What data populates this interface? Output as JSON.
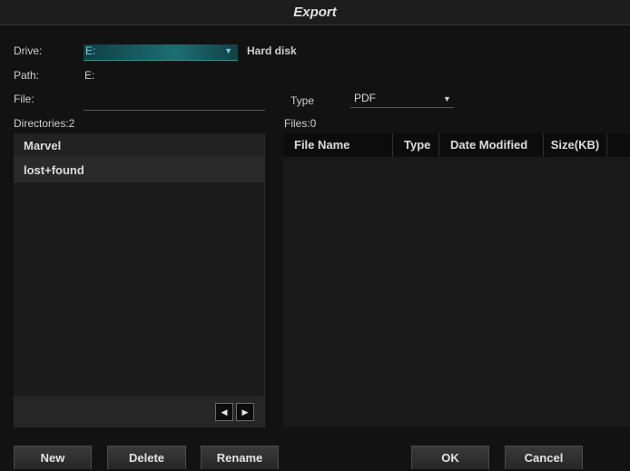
{
  "window": {
    "title": "Export"
  },
  "drive": {
    "label": "Drive:",
    "value": "E:",
    "type_text": "Hard disk"
  },
  "path": {
    "label": "Path:",
    "value": "E:"
  },
  "file": {
    "label": "File:",
    "value": ""
  },
  "type": {
    "label": "Type",
    "value": "PDF"
  },
  "directories": {
    "count_label": "Directories:2",
    "items": [
      {
        "name": "Marvel"
      },
      {
        "name": "lost+found"
      }
    ]
  },
  "files": {
    "count_label": "Files:0",
    "columns": [
      "File Name",
      "Type",
      "Date Modified",
      "Size(KB)"
    ],
    "rows": []
  },
  "buttons": {
    "new": "New",
    "delete": "Delete",
    "rename": "Rename",
    "ok": "OK",
    "cancel": "Cancel"
  },
  "icons": {
    "dropdown": "triangle-down",
    "prev": "triangle-left",
    "next": "triangle-right"
  },
  "colors": {
    "background": "#121212",
    "accent": "#1d6e73",
    "text": "#d6d6d6"
  }
}
